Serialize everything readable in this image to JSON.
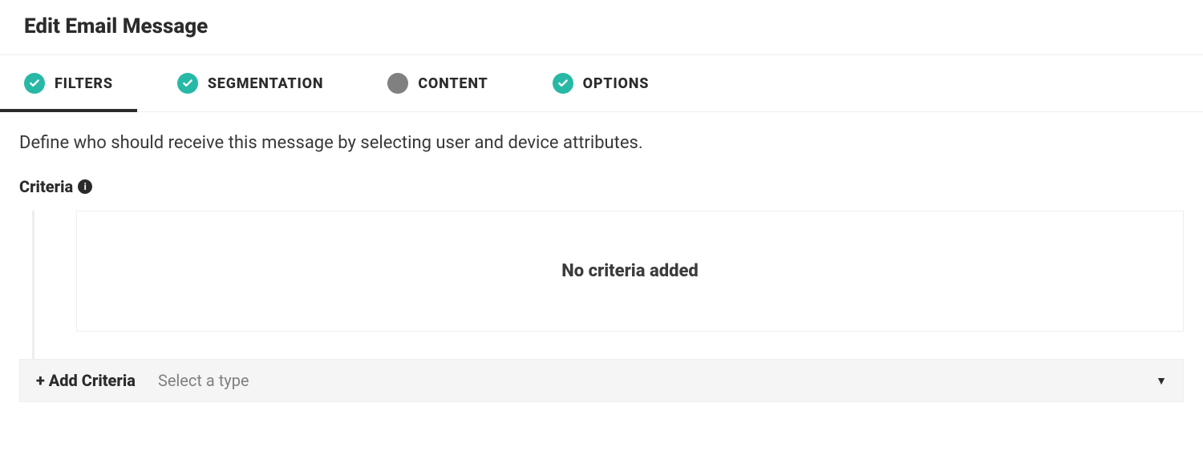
{
  "header": {
    "title": "Edit Email Message"
  },
  "tabs": [
    {
      "label": "FILTERS",
      "status": "check",
      "active": true
    },
    {
      "label": "SEGMENTATION",
      "status": "check",
      "active": false
    },
    {
      "label": "CONTENT",
      "status": "neutral",
      "active": false
    },
    {
      "label": "OPTIONS",
      "status": "check",
      "active": false
    }
  ],
  "description": "Define who should receive this message by selecting user and device attributes.",
  "criteria": {
    "label": "Criteria",
    "empty_message": "No criteria added"
  },
  "add_criteria": {
    "label": "+ Add Criteria",
    "placeholder": "Select a type"
  }
}
